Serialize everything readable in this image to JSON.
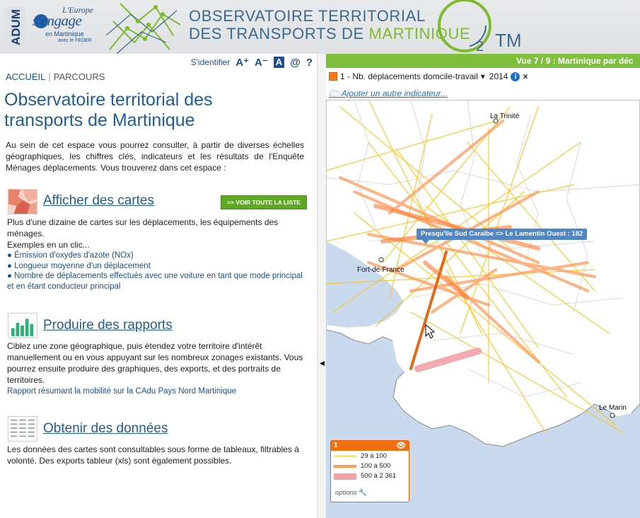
{
  "header": {
    "adum": "ADUM",
    "europe_l1": "L'Europe",
    "europe_l2": "s'engage",
    "europe_l3": "en Martinique",
    "europe_l4": "avec le FEDER",
    "title_line1": "OBSERVATOIRE TERRITORIAL",
    "title_line2_a": "DES TRANSPORTS DE ",
    "title_line2_b": "MARTINIQUE",
    "logo_o": "O",
    "logo_sub": "2",
    "logo_tm": "TM",
    "colors": {
      "blue": "#3a6a8f",
      "green": "#7dbb2d"
    }
  },
  "toolbar": {
    "login": "S'identifier",
    "font_up": "A⁺",
    "font_down": "A⁻",
    "contrast": "A",
    "contact": "@",
    "help": "?"
  },
  "breadcrumb": {
    "home": "ACCUEIL",
    "separator": "|",
    "current": "PARCOURS"
  },
  "page_title": "Observatoire territorial des transports de Martinique",
  "intro": "Au sein de cet espace vous pourrez consulter, à partir de diverses échelles géographiques, les chiffres clés, indicateurs et les résultats de l'Enquête Ménages déplacements. Vous trouverez dans cet espace :",
  "sections": {
    "cartes": {
      "title": "Afficher des cartes",
      "button": ">> VOIR TOUTE LA LISTE",
      "text": "Plus d'une dizaine de cartes sur les déplacements, les équipements des ménages.",
      "examples": "Exemples en un clic...",
      "links": [
        "● Émission d'oxydes d'azote (NOx)",
        "● Longueur moyenne d'un déplacement",
        "● Nombre de déplacements effectués avec une voiture en tant que mode principal et en étant conducteur principal"
      ]
    },
    "rapports": {
      "title": "Produire des rapports",
      "text": "Ciblez une zone géographique, puis étendez votre territoire d'intérêt manuellement ou en vous appuyant sur les nombreux zonages existants. Vous pourrez ensuite produire des graphiques, des exports, et des portraits de territoires.",
      "link": "Rapport résumant la mobilité sur la CAdu Pays Nord Martinique"
    },
    "donnees": {
      "title": "Obtenir des données",
      "text": "Les données des cartes sont consultables sous forme de tableaux, filtrables à volonté. Des exports tableur (xls) sont également possibles."
    }
  },
  "map": {
    "vue_label": "Vue 7 / 9 : Martinique par déc",
    "indicator_label": "1 - Nb. déplacements domcile-travail",
    "indicator_color": "#ff7a1a",
    "year": "2014",
    "add_indicator": "Ajouter un autre indicateur...",
    "places": {
      "trinite": "La Trinité",
      "fdf": "Fort-de-France",
      "marin": "Le Marin"
    },
    "tooltip": "Presqu'île Sud Caraïbe => Le Lamentin Ouest : 182",
    "legend": {
      "number": "1",
      "eye_icon": "eye-icon",
      "rows": [
        {
          "label": "29 à 100",
          "color": "#ffc21a",
          "width": 1
        },
        {
          "label": "100 à 500",
          "color": "#ff9a5a",
          "width": 4
        },
        {
          "label": "500 à 2 361",
          "color": "#f4a0a8",
          "width": 9
        }
      ],
      "options": "options"
    }
  }
}
